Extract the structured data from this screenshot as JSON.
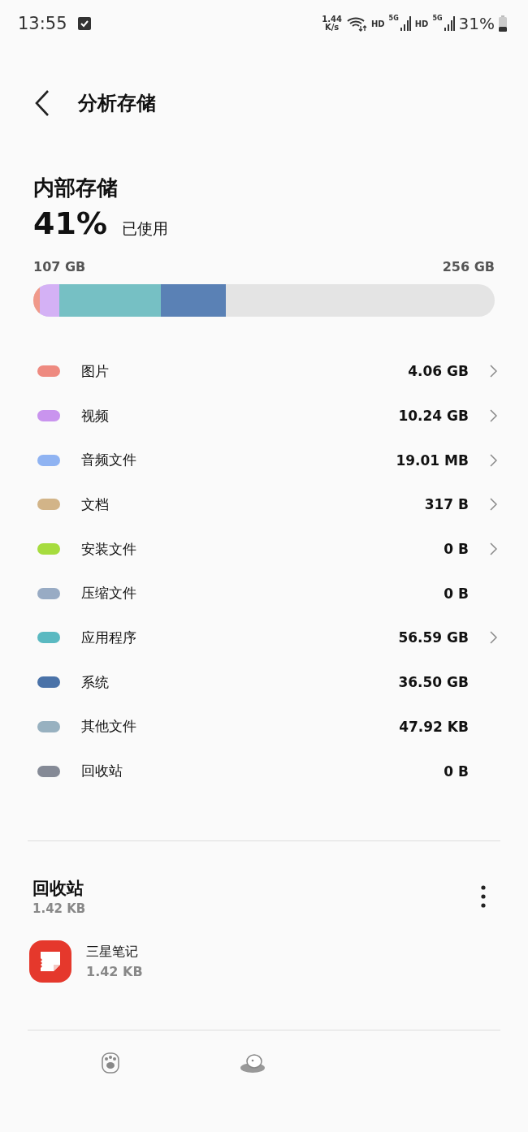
{
  "status_bar": {
    "time": "13:55",
    "speed_value": "1.44",
    "speed_unit": "K/s",
    "hd_1": "HD",
    "net_1": "5G",
    "hd_2": "HD",
    "net_2": "5G",
    "battery": "31%"
  },
  "header": {
    "title": "分析存储"
  },
  "storage": {
    "title": "内部存储",
    "percent": "41%",
    "used_label": "已使用",
    "used": "107 GB",
    "total": "256 GB",
    "segments": [
      {
        "color": "#f0998a"
      },
      {
        "color": "#d4b1f5"
      },
      {
        "color": "#76c0c4"
      },
      {
        "color": "#5a81b5"
      }
    ]
  },
  "categories": [
    {
      "label": "图片",
      "size": "4.06 GB",
      "color": "#ee8a80",
      "chevron": true
    },
    {
      "label": "视频",
      "size": "10.24 GB",
      "color": "#c994ee",
      "chevron": true
    },
    {
      "label": "音频文件",
      "size": "19.01 MB",
      "color": "#8fb3f2",
      "chevron": true
    },
    {
      "label": "文档",
      "size": "317 B",
      "color": "#d2b488",
      "chevron": true
    },
    {
      "label": "安装文件",
      "size": "0 B",
      "color": "#a6dc3e",
      "chevron": true
    },
    {
      "label": "压缩文件",
      "size": "0 B",
      "color": "#98abc4",
      "chevron": false
    },
    {
      "label": "应用程序",
      "size": "56.59 GB",
      "color": "#5ab9c1",
      "chevron": true
    },
    {
      "label": "系统",
      "size": "36.50 GB",
      "color": "#4a72a8",
      "chevron": false
    },
    {
      "label": "其他文件",
      "size": "47.92 KB",
      "color": "#98b1c0",
      "chevron": false
    },
    {
      "label": "回收站",
      "size": "0 B",
      "color": "#858a96",
      "chevron": false
    }
  ],
  "recycle": {
    "title": "回收站",
    "size": "1.42 KB",
    "apps": [
      {
        "name": "三星笔记",
        "size": "1.42 KB"
      }
    ]
  }
}
